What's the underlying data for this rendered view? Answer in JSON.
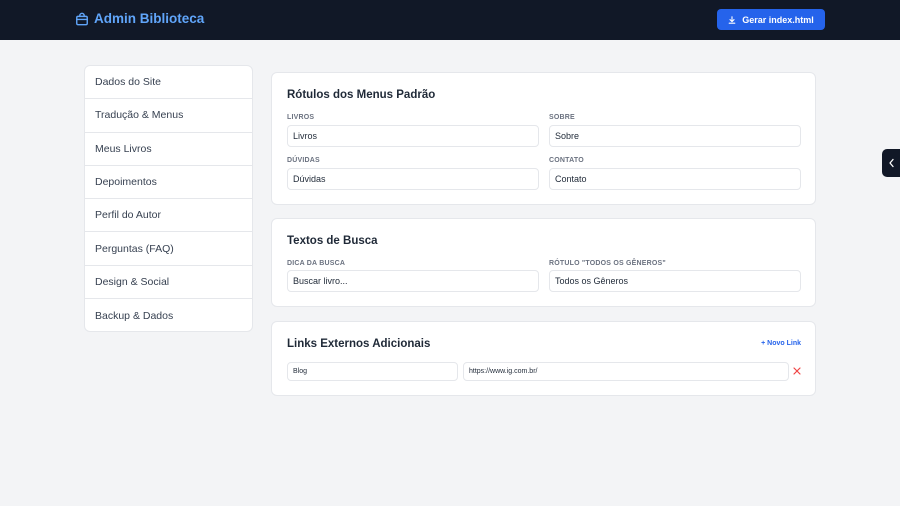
{
  "header": {
    "brand_icon": "shopping-bag-icon",
    "title": "Admin Biblioteca",
    "generate_button": "Gerar index.html",
    "generate_icon": "download-icon"
  },
  "sidebar": {
    "items": [
      {
        "label": "Dados do Site"
      },
      {
        "label": "Tradução & Menus"
      },
      {
        "label": "Meus Livros"
      },
      {
        "label": "Depoimentos"
      },
      {
        "label": "Perfil do Autor"
      },
      {
        "label": "Perguntas (FAQ)"
      },
      {
        "label": "Design & Social"
      },
      {
        "label": "Backup & Dados"
      }
    ]
  },
  "menu_labels": {
    "title": "Rótulos dos Menus Padrão",
    "books": {
      "label": "LIVROS",
      "value": "Livros"
    },
    "about": {
      "label": "SOBRE",
      "value": "Sobre"
    },
    "faq": {
      "label": "DÚVIDAS",
      "value": "Dúvidas"
    },
    "contact": {
      "label": "CONTATO",
      "value": "Contato"
    }
  },
  "search_texts": {
    "title": "Textos de Busca",
    "hint": {
      "label": "DICA DA BUSCA",
      "value": "Buscar livro..."
    },
    "all_genres": {
      "label": "RÓTULO \"TODOS OS GÊNEROS\"",
      "value": "Todos os Gêneros"
    }
  },
  "external_links": {
    "title": "Links Externos Adicionais",
    "new_link": "+ Novo Link",
    "links": [
      {
        "name": "Blog",
        "url": "https://www.ig.com.br/"
      }
    ],
    "remove_icon": "close-icon"
  },
  "side_tab": {
    "icon": "chevron-left-icon"
  },
  "colors": {
    "header_bg": "#111827",
    "brand": "#60a5fa",
    "accent": "#2563eb",
    "danger": "#ef4444",
    "page_bg": "#f3f4f6"
  }
}
